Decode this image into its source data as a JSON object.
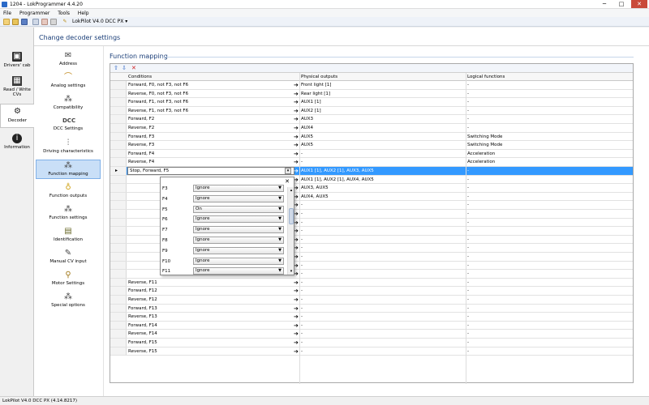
{
  "window": {
    "title": "1204 - LokProgrammer 4.4.20",
    "minimize": "─",
    "maximize": "□",
    "close": "✕"
  },
  "menu": [
    "File",
    "Programmer",
    "Tools",
    "Help"
  ],
  "toolbar": {
    "decoder_combo": "LokPilot V4.0 DCC PX",
    "combo_arrow": "▾"
  },
  "nav": [
    {
      "label": "Drivers' cab",
      "icon": "cab-icon"
    },
    {
      "label": "Read / Write CVs",
      "icon": "cv-icon"
    },
    {
      "label": "Decoder",
      "icon": "decoder-icon",
      "active": true
    },
    {
      "label": "Information",
      "icon": "info-icon"
    }
  ],
  "header": {
    "title": "Change decoder settings"
  },
  "settings": [
    {
      "label": "Address",
      "icon": "envelope-icon"
    },
    {
      "label": "Analog settings",
      "icon": "analog-icon"
    },
    {
      "label": "Compatibility",
      "icon": "compat-icon"
    },
    {
      "label": "DCC Settings",
      "icon": "dcc-icon"
    },
    {
      "label": "Driving characteristics",
      "icon": "sliders-icon"
    },
    {
      "label": "Function mapping",
      "icon": "mapping-icon",
      "active": true
    },
    {
      "label": "Function outputs",
      "icon": "bulb-icon"
    },
    {
      "label": "Function settings",
      "icon": "fsettings-icon"
    },
    {
      "label": "Identification",
      "icon": "id-icon"
    },
    {
      "label": "Manual CV input",
      "icon": "pen-icon"
    },
    {
      "label": "Motor Settings",
      "icon": "motor-icon"
    },
    {
      "label": "Special options",
      "icon": "special-icon"
    }
  ],
  "function_mapping": {
    "title": "Function mapping",
    "columns": [
      "Conditions",
      "Physical outputs",
      "Logical functions"
    ],
    "rows": [
      {
        "c": "Forward, F0, not F3, not F6",
        "p": "Front light [1]",
        "l": "-"
      },
      {
        "c": "Reverse, F0, not F3, not F6",
        "p": "Rear light [1]",
        "l": "-"
      },
      {
        "c": "Forward, F1, not F3, not F6",
        "p": "AUX1 [1]",
        "l": "-"
      },
      {
        "c": "Reverse, F1, not F3, not F6",
        "p": "AUX2 [1]",
        "l": "-"
      },
      {
        "c": "Forward, F2",
        "p": "AUX3",
        "l": "-"
      },
      {
        "c": "Reverse, F2",
        "p": "AUX4",
        "l": "-"
      },
      {
        "c": "Forward, F3",
        "p": "AUX5",
        "l": "Switching Mode"
      },
      {
        "c": "Reverse, F3",
        "p": "AUX5",
        "l": "Switching Mode"
      },
      {
        "c": "Forward, F4",
        "p": "-",
        "l": "Acceleration"
      },
      {
        "c": "Reverse, F4",
        "p": "-",
        "l": "Acceleration"
      },
      {
        "c": "Stop, Forward, F5",
        "p": "AUX1 [1], AUX2 [1], AUX3, AUX5",
        "l": "-",
        "selected": true
      },
      {
        "c": "",
        "p": "AUX1 [1], AUX2 [1], AUX4, AUX5",
        "l": "-"
      },
      {
        "c": "",
        "p": "AUX3, AUX5",
        "l": "-"
      },
      {
        "c": "",
        "p": "AUX4, AUX5",
        "l": "-"
      },
      {
        "c": "",
        "p": "-",
        "l": "-"
      },
      {
        "c": "",
        "p": "-",
        "l": "-"
      },
      {
        "c": "",
        "p": "-",
        "l": "-"
      },
      {
        "c": "",
        "p": "-",
        "l": "-"
      },
      {
        "c": "",
        "p": "-",
        "l": "-"
      },
      {
        "c": "",
        "p": "-",
        "l": "-"
      },
      {
        "c": "",
        "p": "-",
        "l": "-"
      },
      {
        "c": "",
        "p": "-",
        "l": "-"
      },
      {
        "c": "",
        "p": "-",
        "l": "-"
      },
      {
        "c": "Reverse, F11",
        "p": "-",
        "l": "-"
      },
      {
        "c": "Forward, F12",
        "p": "-",
        "l": "-"
      },
      {
        "c": "Reverse, F12",
        "p": "-",
        "l": "-"
      },
      {
        "c": "Forward, F13",
        "p": "-",
        "l": "-"
      },
      {
        "c": "Reverse, F13",
        "p": "-",
        "l": "-"
      },
      {
        "c": "Forward, F14",
        "p": "-",
        "l": "-"
      },
      {
        "c": "Reverse, F14",
        "p": "-",
        "l": "-"
      },
      {
        "c": "Forward, F15",
        "p": "-",
        "l": "-"
      },
      {
        "c": "Reverse, F15",
        "p": "-",
        "l": "-"
      }
    ]
  },
  "popup": {
    "close": "✕",
    "items": [
      {
        "fn": "F3",
        "value": "Ignore"
      },
      {
        "fn": "F4",
        "value": "Ignore"
      },
      {
        "fn": "F5",
        "value": "On"
      },
      {
        "fn": "F6",
        "value": "Ignore"
      },
      {
        "fn": "F7",
        "value": "Ignore"
      },
      {
        "fn": "F8",
        "value": "Ignore"
      },
      {
        "fn": "F9",
        "value": "Ignore"
      },
      {
        "fn": "F10",
        "value": "Ignore"
      },
      {
        "fn": "F11",
        "value": "Ignore"
      }
    ]
  },
  "status": {
    "text": "LokPilot V4.0 DCC PX (4.14.8217)"
  }
}
